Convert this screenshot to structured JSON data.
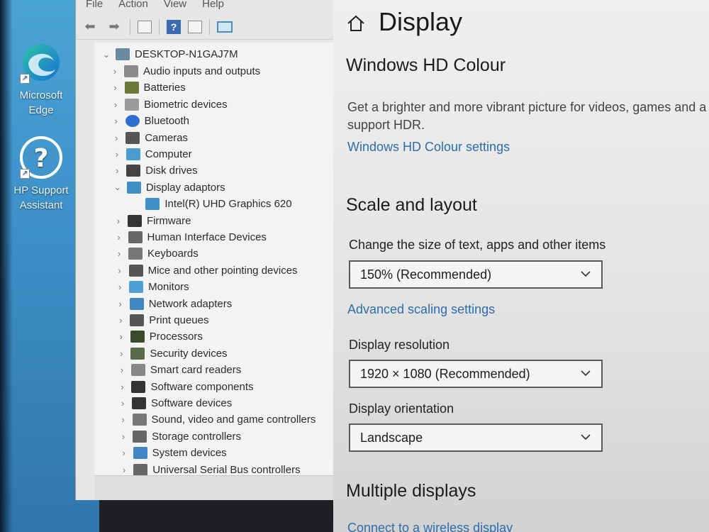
{
  "desktop": {
    "icons": [
      {
        "label": "Microsoft Edge",
        "icon": "edge-icon"
      },
      {
        "label": "HP Support Assistant",
        "icon": "help-question-icon"
      }
    ]
  },
  "device_manager": {
    "menu": [
      "File",
      "Action",
      "View",
      "Help"
    ],
    "toolbar": [
      "back-arrow-icon",
      "forward-arrow-icon",
      "properties-icon",
      "help-icon",
      "details-icon",
      "monitor-icon"
    ],
    "computer_name": "DESKTOP-N1GAJ7M",
    "items": [
      {
        "label": "Audio inputs and outputs",
        "icon": "speaker-icon"
      },
      {
        "label": "Batteries",
        "icon": "battery-icon"
      },
      {
        "label": "Biometric devices",
        "icon": "fingerprint-icon"
      },
      {
        "label": "Bluetooth",
        "icon": "bluetooth-icon"
      },
      {
        "label": "Cameras",
        "icon": "camera-icon"
      },
      {
        "label": "Computer",
        "icon": "computer-icon"
      },
      {
        "label": "Disk drives",
        "icon": "disk-icon"
      },
      {
        "label": "Display adaptors",
        "icon": "display-adapter-icon",
        "expanded": true
      },
      {
        "label": "Intel(R) UHD Graphics 620",
        "icon": "display-adapter-icon",
        "child": true
      },
      {
        "label": "Firmware",
        "icon": "firmware-icon"
      },
      {
        "label": "Human Interface Devices",
        "icon": "hid-icon"
      },
      {
        "label": "Keyboards",
        "icon": "keyboard-icon"
      },
      {
        "label": "Mice and other pointing devices",
        "icon": "mouse-icon"
      },
      {
        "label": "Monitors",
        "icon": "monitor-icon"
      },
      {
        "label": "Network adapters",
        "icon": "network-icon"
      },
      {
        "label": "Print queues",
        "icon": "printer-icon"
      },
      {
        "label": "Processors",
        "icon": "processor-icon"
      },
      {
        "label": "Security devices",
        "icon": "security-icon"
      },
      {
        "label": "Smart card readers",
        "icon": "smart-card-icon"
      },
      {
        "label": "Software components",
        "icon": "software-component-icon"
      },
      {
        "label": "Software devices",
        "icon": "software-device-icon"
      },
      {
        "label": "Sound, video and game controllers",
        "icon": "sound-icon"
      },
      {
        "label": "Storage controllers",
        "icon": "storage-icon"
      },
      {
        "label": "System devices",
        "icon": "system-icon"
      },
      {
        "label": "Universal Serial Bus controllers",
        "icon": "usb-icon"
      }
    ]
  },
  "settings": {
    "title": "Display",
    "hdr": {
      "heading": "Windows HD Colour",
      "desc_line1": "Get a brighter and more vibrant picture for videos, games and a",
      "desc_line2": "support HDR.",
      "link": "Windows HD Colour settings"
    },
    "scale": {
      "heading": "Scale and layout",
      "size_label": "Change the size of text, apps and other items",
      "size_value": "150% (Recommended)",
      "advanced_link": "Advanced scaling settings",
      "resolution_label": "Display resolution",
      "resolution_value": "1920 × 1080 (Recommended)",
      "orientation_label": "Display orientation",
      "orientation_value": "Landscape"
    },
    "multiple": {
      "heading": "Multiple displays",
      "link": "Connect to a wireless display"
    }
  },
  "colors": {
    "link": "#2e6da8",
    "desktop_blue": "#3c8fc7"
  }
}
